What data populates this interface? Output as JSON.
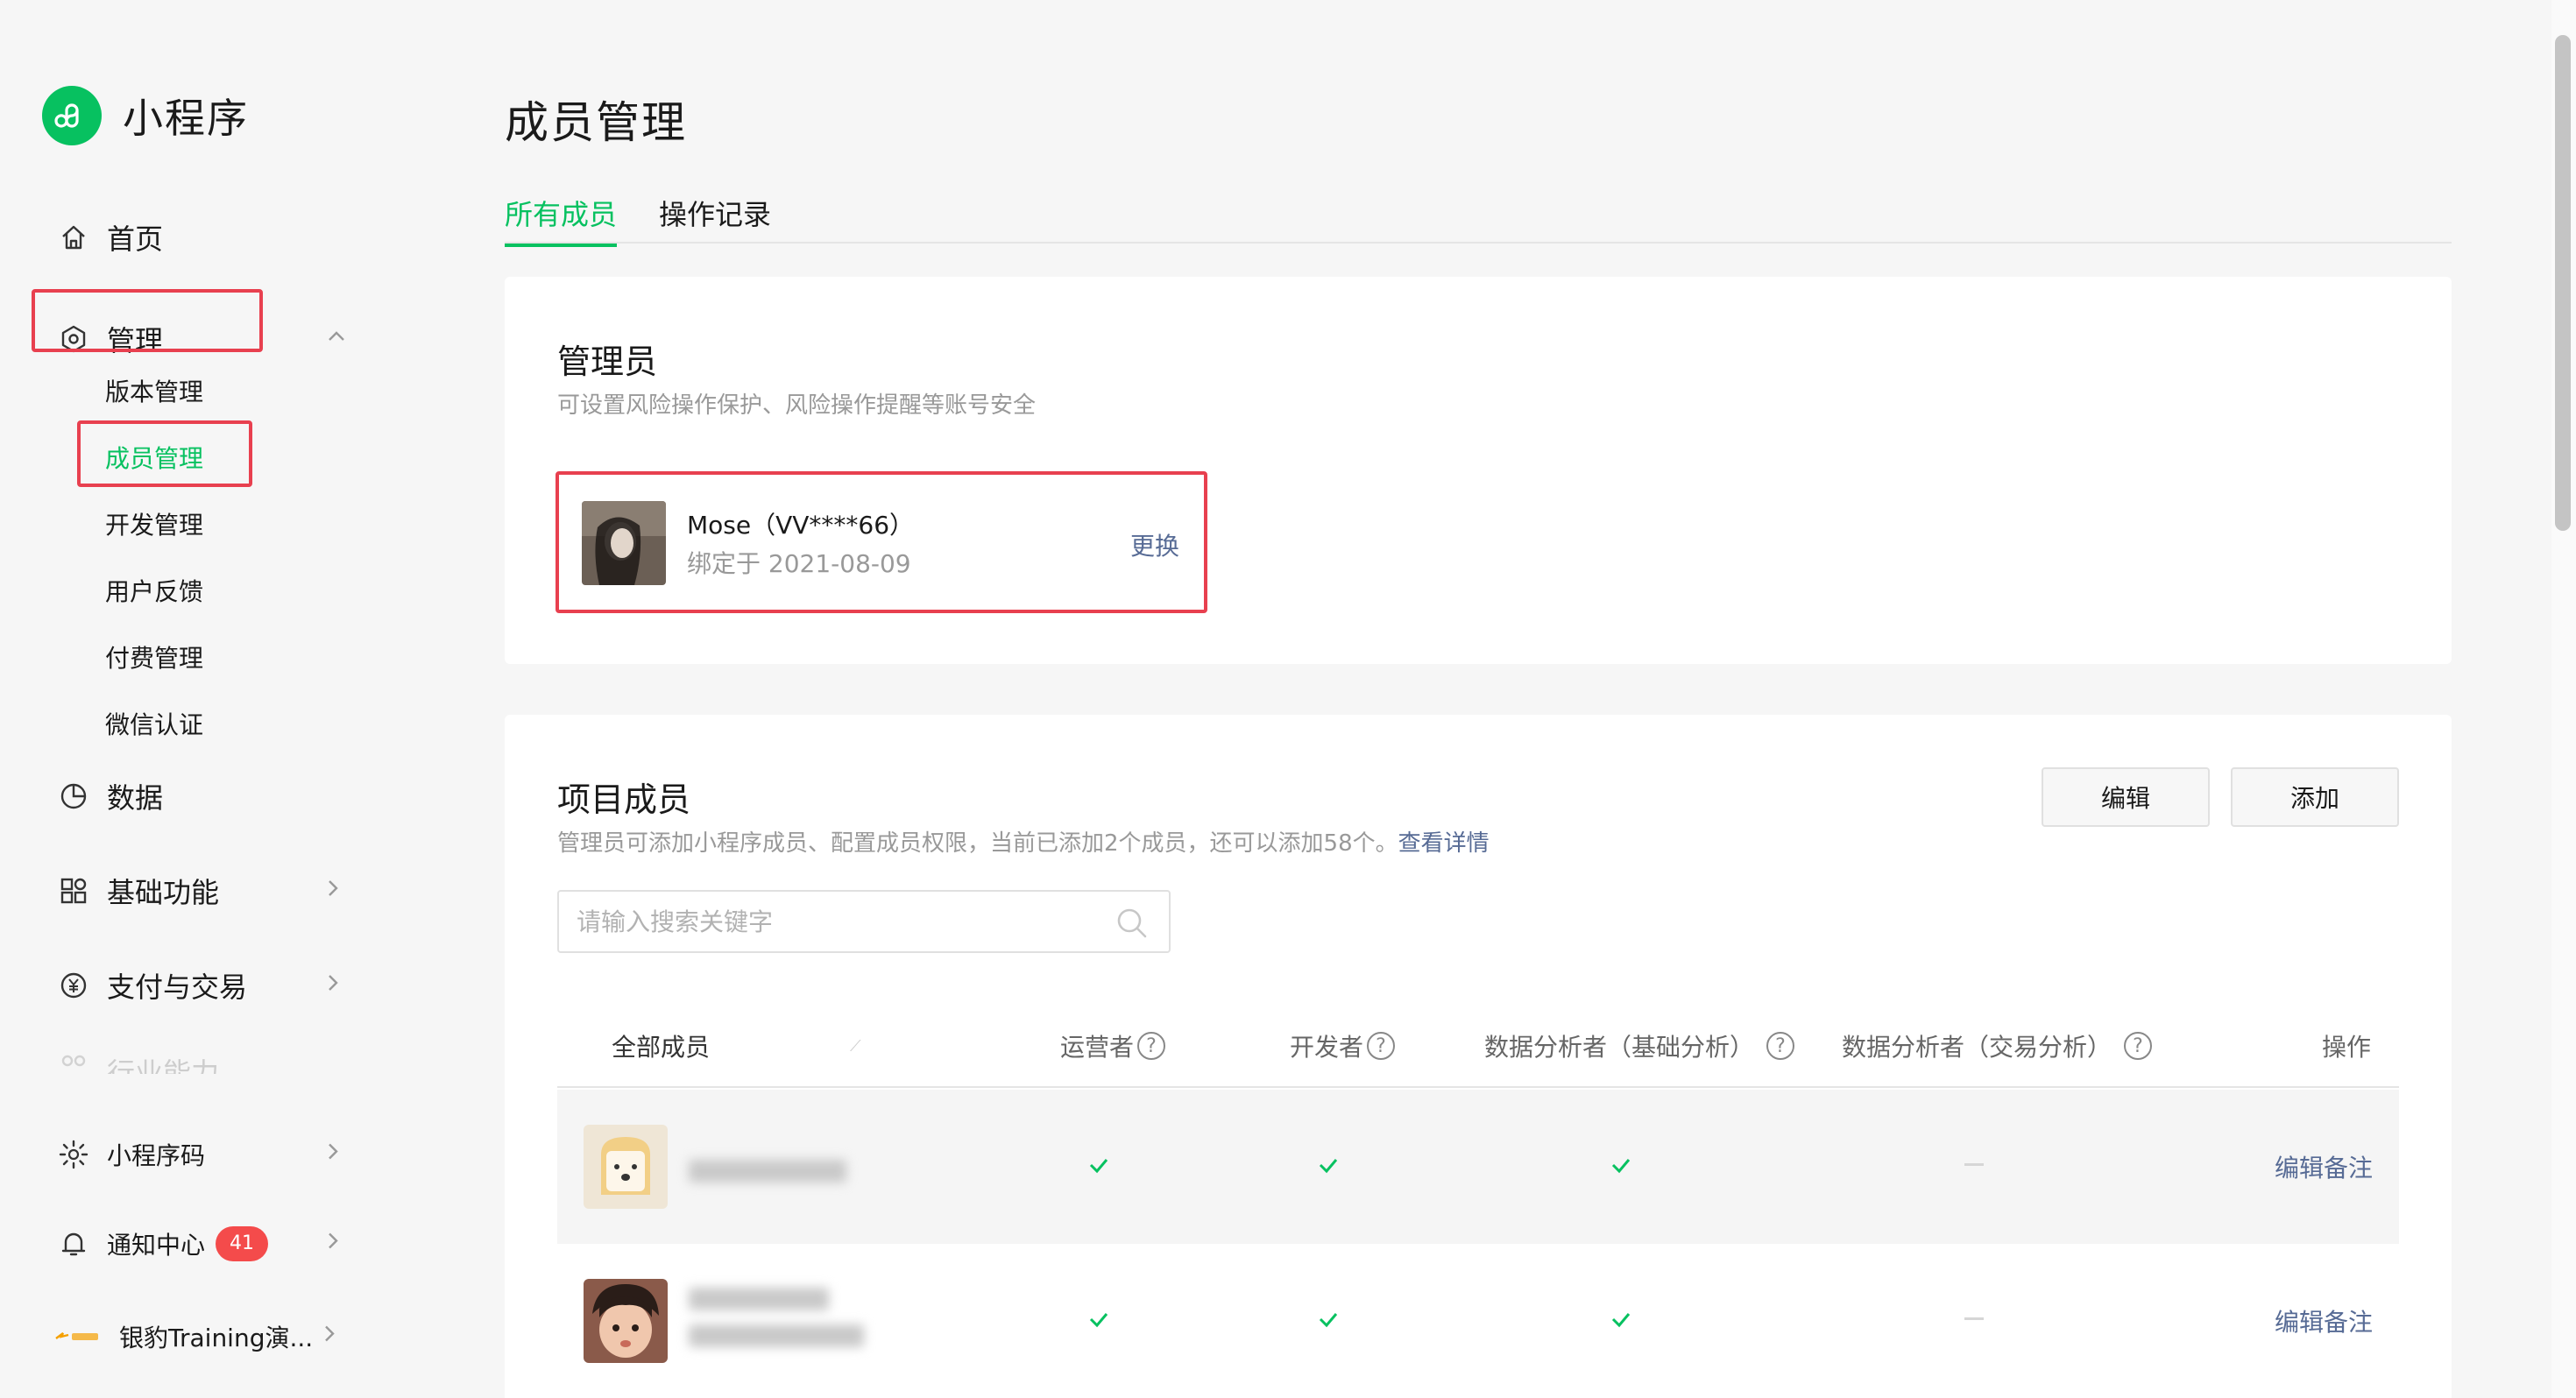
{
  "app": {
    "name": "小程序",
    "brand_color": "#07c160"
  },
  "sidebar": {
    "home": "首页",
    "manage": "管理",
    "manage_children": [
      "版本管理",
      "成员管理",
      "开发管理",
      "用户反馈",
      "付费管理",
      "微信认证"
    ],
    "data": "数据",
    "basic": "基础功能",
    "pay": "支付与交易",
    "industry": "行业能力",
    "qrcode": "小程序码",
    "notify": "通知中心",
    "notify_count": "41",
    "org": "银豹Training演..."
  },
  "page": {
    "title": "成员管理"
  },
  "tabs": [
    "所有成员",
    "操作记录"
  ],
  "admin": {
    "title": "管理员",
    "desc": "可设置风险操作保护、风险操作提醒等账号安全",
    "name": "Mose（VV****66）",
    "bound": "绑定于 2021-08-09",
    "change": "更换"
  },
  "members": {
    "title": "项目成员",
    "desc": "管理员可添加小程序成员、配置成员权限，当前已添加2个成员，还可以添加58个。",
    "desc_link": "查看详情",
    "edit_btn": "编辑",
    "add_btn": "添加",
    "search_placeholder": "请输入搜索关键字",
    "columns": [
      "全部成员",
      "运营者",
      "开发者",
      "数据分析者（基础分析）",
      "数据分析者（交易分析）",
      "操作"
    ],
    "rows": [
      {
        "operator": true,
        "developer": true,
        "analyst_basic": true,
        "analyst_trade": false,
        "action": "编辑备注"
      },
      {
        "operator": true,
        "developer": true,
        "analyst_basic": true,
        "analyst_trade": false,
        "action": "编辑备注"
      }
    ]
  },
  "colors": {
    "highlight": "#e8404f",
    "link": "#576b95",
    "badge": "#f44b4b"
  }
}
